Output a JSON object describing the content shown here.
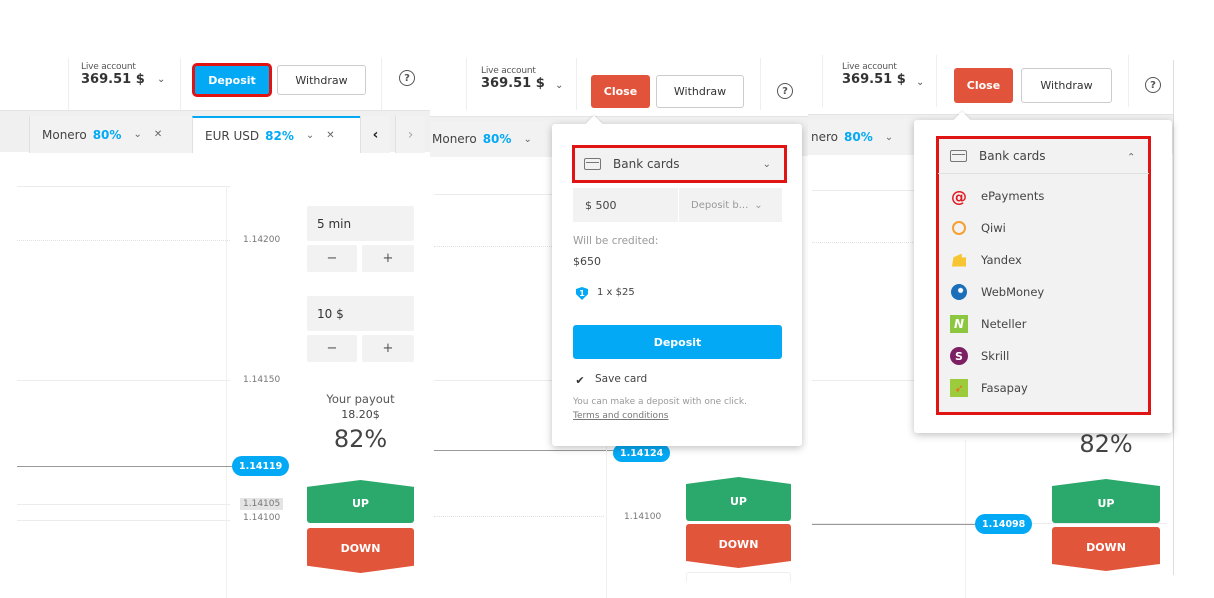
{
  "account": {
    "label": "Live account",
    "balance": "369.51 $",
    "chevron_icon": "chevron-down-icon"
  },
  "header": {
    "deposit_label": "Deposit",
    "close_label": "Close",
    "withdraw_label": "Withdraw",
    "help_icon": "help-icon",
    "help_glyph": "?"
  },
  "tabs": [
    {
      "name": "Monero",
      "payout": "80%"
    },
    {
      "name": "EUR USD",
      "payout": "82%"
    }
  ],
  "tab_controls": {
    "chevron": "⌄",
    "close": "✕",
    "prev": "‹",
    "next": "›"
  },
  "chart": {
    "panel1": {
      "ticks": [
        "1.14200",
        "1.14150",
        "1.14105",
        "1.14100"
      ],
      "current_price": "1.14119"
    },
    "panel2": {
      "ticks": [
        "1.14100"
      ],
      "current_price": "1.14124"
    },
    "panel3": {
      "current_price": "1.14098"
    }
  },
  "trade": {
    "duration": "5 min",
    "amount": "10 $",
    "minus": "−",
    "plus": "+",
    "payout_label": "Your payout",
    "payout_amount": "18.20$",
    "payout_percent": "82%",
    "up_label": "UP",
    "down_label": "DOWN"
  },
  "deposit_popover": {
    "method_selected": "Bank cards",
    "amount": "$ 500",
    "deposit_by_placeholder": "Deposit b...",
    "credited_label": "Will be credited:",
    "credited_value": "$650",
    "bonus_badge": "1",
    "bonus_text": "1 x $25",
    "deposit_button": "Deposit",
    "save_card_label": "Save card",
    "save_card_checked": true,
    "checkmark": "✔",
    "one_click_note": "You can make a deposit with one click.",
    "terms_link": "Terms and conditions"
  },
  "method_dropdown": {
    "selected": "Bank cards",
    "expanded": true,
    "methods": [
      {
        "label": "ePayments",
        "icon": "epayments-icon"
      },
      {
        "label": "Qiwi",
        "icon": "qiwi-icon"
      },
      {
        "label": "Yandex",
        "icon": "yandex-icon"
      },
      {
        "label": "WebMoney",
        "icon": "webmoney-icon"
      },
      {
        "label": "Neteller",
        "icon": "neteller-icon"
      },
      {
        "label": "Skrill",
        "icon": "skrill-icon"
      },
      {
        "label": "Fasapay",
        "icon": "fasapay-icon"
      }
    ],
    "icon_glyphs": {
      "epayments": "@",
      "neteller": "N",
      "skrill": "S",
      "fasapay": "➶"
    }
  },
  "colors": {
    "accent_blue": "#03a9f4",
    "close_red": "#e1533a",
    "up_green": "#2ba86b",
    "down_red": "#e1553b",
    "highlight_red": "#e11414"
  }
}
